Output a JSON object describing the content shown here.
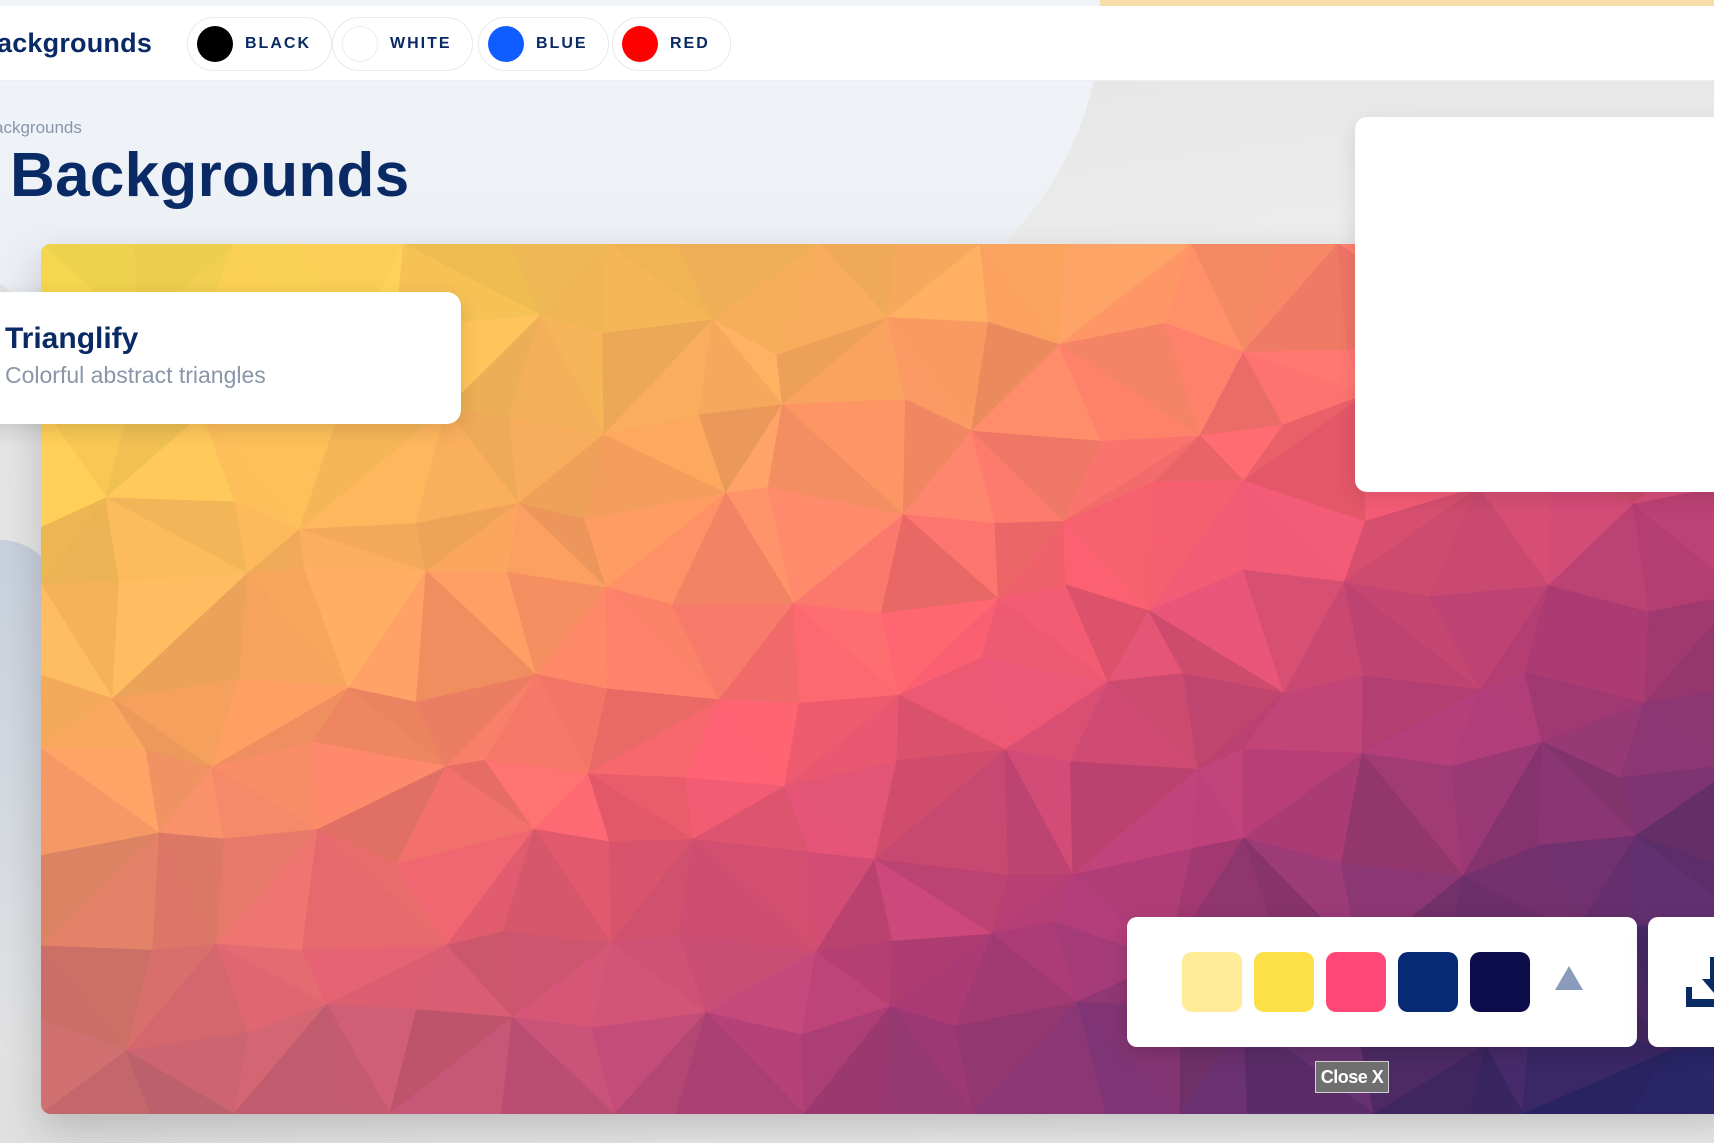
{
  "navbar": {
    "title": "ackgrounds",
    "color_chips": [
      {
        "label": "BLACK",
        "color": "#000000"
      },
      {
        "label": "WHITE",
        "color": "#ffffff"
      },
      {
        "label": "BLUE",
        "color": "#0f5cff"
      },
      {
        "label": "RED",
        "color": "#ff0000"
      }
    ]
  },
  "breadcrumb": "ackgrounds",
  "page_title": "Backgrounds",
  "info_card": {
    "title": "Trianglify",
    "subtitle": "Colorful abstract triangles"
  },
  "palette": {
    "swatches": [
      "#ffeb98",
      "#fde047",
      "#ff4777",
      "#062a74",
      "#0d0c4a"
    ],
    "toggle_icon": "triangle-up-icon"
  },
  "download": {
    "icon": "download-icon"
  },
  "close_button": {
    "label": "Close X"
  },
  "colors": {
    "brand_navy": "#0a2a66",
    "muted_text": "#8a96a8"
  }
}
